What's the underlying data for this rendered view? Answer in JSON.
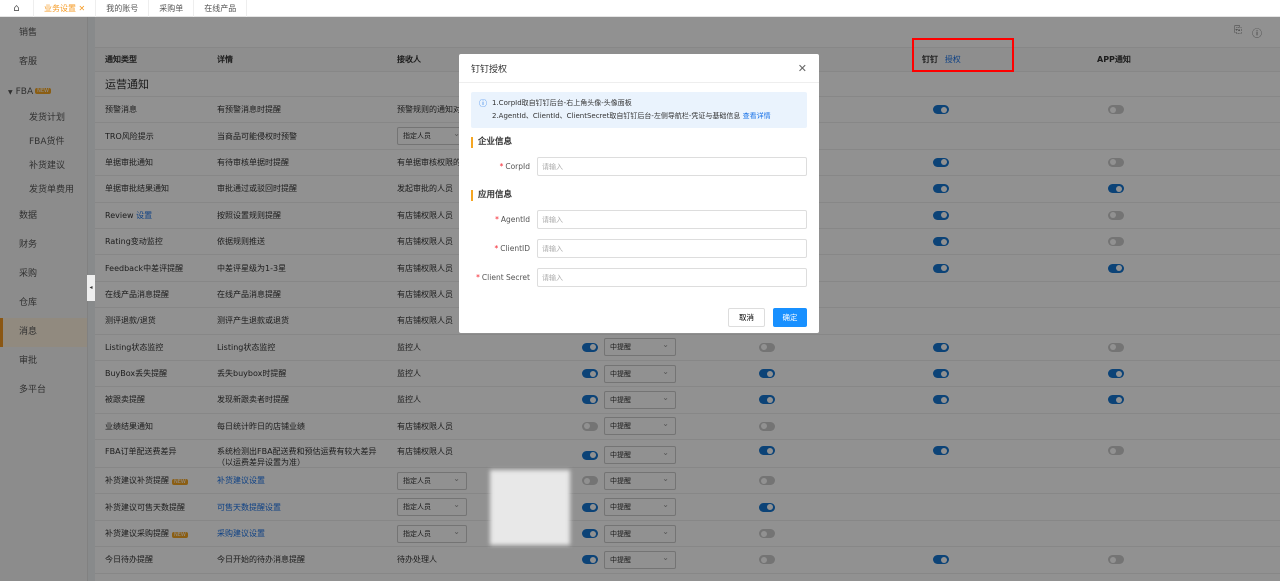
{
  "tabs": [
    {
      "label": "业务设置",
      "active": true
    },
    {
      "label": "我的账号"
    },
    {
      "label": "采购单"
    },
    {
      "label": "在线产品"
    }
  ],
  "sidebar": {
    "items": [
      {
        "label": "销售"
      },
      {
        "label": "客服"
      },
      {
        "label": "FBA",
        "badge": "NEW"
      },
      {
        "label": "发货计划",
        "sub": true
      },
      {
        "label": "FBA货件",
        "sub": true
      },
      {
        "label": "补货建议",
        "sub": true
      },
      {
        "label": "发货单费用",
        "sub": true
      },
      {
        "label": "数据"
      },
      {
        "label": "财务"
      },
      {
        "label": "采购"
      },
      {
        "label": "仓库"
      },
      {
        "label": "消息",
        "active": true
      },
      {
        "label": "审批"
      },
      {
        "label": "多平台"
      }
    ]
  },
  "table": {
    "headers": {
      "type": "通知类型",
      "detail": "详情",
      "receiver": "接收人",
      "dingtalk": "钉钉",
      "dingtalk_auth": "授权",
      "app": "APP通知"
    },
    "section": "运营通知",
    "select_value": "中提醒",
    "rows": [
      {
        "type": "预警消息",
        "detail": "有预警消息时提醒",
        "receiver": "预警规则的通知对象",
        "ding": true,
        "app": false
      },
      {
        "type": "TRO风险提示",
        "detail": "当商品可能侵权时预警",
        "receiver_select": "指定人员"
      },
      {
        "type": "单据审批通知",
        "detail": "有待审核单据时提醒",
        "receiver": "有单据审核权限的人员",
        "ding": true,
        "app": false
      },
      {
        "type": "单据审批结果通知",
        "detail": "审批通过或驳回时提醒",
        "receiver": "发起审批的人员",
        "ding": true,
        "app": true
      },
      {
        "type": "Review",
        "type_link": "设置",
        "detail": "按照设置规则提醒",
        "receiver": "有店铺权限人员",
        "ding": true,
        "app": false
      },
      {
        "type": "Rating变动监控",
        "detail": "依据规则推送",
        "receiver": "有店铺权限人员",
        "ding": true,
        "app": false
      },
      {
        "type": "Feedback中差评提醒",
        "detail": "中差评星级为1-3星",
        "receiver": "有店铺权限人员",
        "ding": true,
        "app": true
      },
      {
        "type": "在线产品消息提醒",
        "detail": "在线产品消息提醒",
        "receiver": "有店铺权限人员"
      },
      {
        "type": "测评退款/退货",
        "detail": "测评产生退款或退货",
        "receiver": "有店铺权限人员"
      },
      {
        "type": "Listing状态监控",
        "detail": "Listing状态监控",
        "receiver": "监控人",
        "t1": true,
        "t2": false,
        "ding": true,
        "app": false
      },
      {
        "type": "BuyBox丢失提醒",
        "detail": "丢失buybox时提醒",
        "receiver": "监控人",
        "t1": true,
        "t2": true,
        "ding": true,
        "app": true
      },
      {
        "type": "被跟卖提醒",
        "detail": "发现新跟卖者时提醒",
        "receiver": "监控人",
        "t1": true,
        "t2": true,
        "ding": true,
        "app": true
      },
      {
        "type": "业绩结果通知",
        "detail": "每日统计昨日的店铺业绩",
        "receiver": "有店铺权限人员",
        "t1": false,
        "t2": false
      },
      {
        "type": "FBA订单配送费差异",
        "detail": "系统检测出FBA配送费和预估运费有较大差异（以运费差异设置为准）",
        "receiver": "有店铺权限人员",
        "t1": true,
        "t2": true,
        "ding": true,
        "app": false
      },
      {
        "type": "补货建议补货提醒",
        "badge": "NEW",
        "detail_link": "补货建议设置",
        "receiver_select": "指定人员",
        "t1": false,
        "t2": false
      },
      {
        "type": "补货建议可售天数提醒",
        "detail_link": "可售天数提醒设置",
        "receiver_select": "指定人员",
        "t1": true,
        "t2": true
      },
      {
        "type": "补货建议采购提醒",
        "badge": "NEW",
        "detail_link": "采购建议设置",
        "receiver_select": "指定人员",
        "t1": true,
        "t2": false
      },
      {
        "type": "今日待办提醒",
        "detail": "今日开始的待办消息提醒",
        "receiver": "待办处理人",
        "t1": true,
        "t2": false,
        "ding": true,
        "app": false
      }
    ]
  },
  "modal": {
    "title": "钉钉授权",
    "alert_line1": "1.CorpId取自钉钉后台-右上角头像-头像面板",
    "alert_line2": "2.AgentId、ClientId、ClientSecret取自钉钉后台-左侧导航栏-凭证与基础信息",
    "alert_link": "查看详情",
    "section_enterprise": "企业信息",
    "section_app": "应用信息",
    "fields": [
      {
        "label": "CorpId",
        "placeholder": "请输入"
      },
      {
        "label": "AgentId",
        "placeholder": "请输入"
      },
      {
        "label": "ClientID",
        "placeholder": "请输入"
      },
      {
        "label": "Client Secret",
        "placeholder": "请输入"
      }
    ],
    "cancel": "取消",
    "confirm": "确定"
  }
}
